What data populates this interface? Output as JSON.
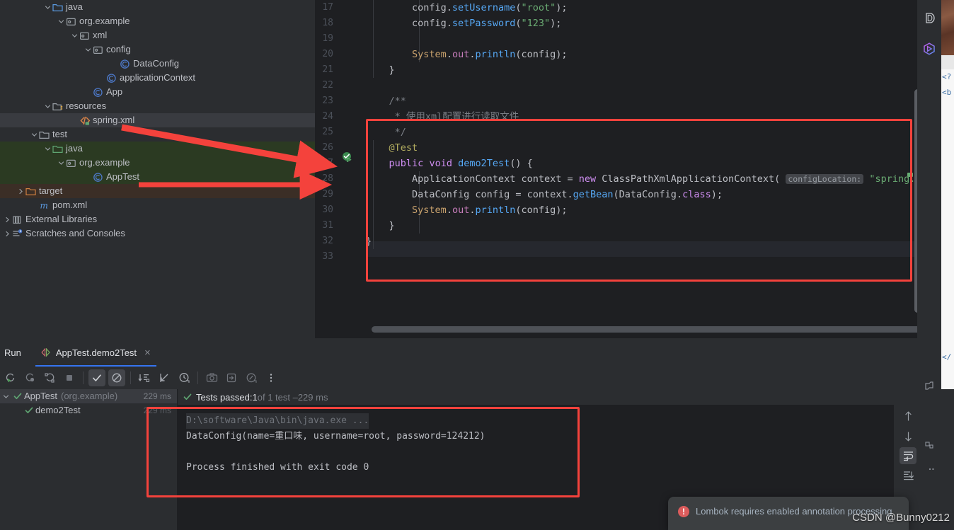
{
  "project_tree": {
    "items": [
      {
        "label": "java",
        "icon": "folder-source-icon",
        "indent": 3,
        "chevron": "down",
        "state": "normal"
      },
      {
        "label": "org.example",
        "icon": "package-icon",
        "indent": 4,
        "chevron": "down",
        "state": "normal"
      },
      {
        "label": "xml",
        "icon": "package-icon",
        "indent": 5,
        "chevron": "down",
        "state": "normal"
      },
      {
        "label": "config",
        "icon": "package-icon",
        "indent": 6,
        "chevron": "down",
        "state": "normal"
      },
      {
        "label": "DataConfig",
        "icon": "java-class-icon",
        "indent": 8,
        "chevron": "none",
        "state": "normal"
      },
      {
        "label": "applicationContext",
        "icon": "java-class-icon",
        "indent": 7,
        "chevron": "none",
        "state": "normal"
      },
      {
        "label": "App",
        "icon": "java-class-icon",
        "indent": 6,
        "chevron": "none",
        "state": "normal"
      },
      {
        "label": "resources",
        "icon": "folder-resources-icon",
        "indent": 3,
        "chevron": "down",
        "state": "normal"
      },
      {
        "label": "spring.xml",
        "icon": "xml-file-icon",
        "indent": 5,
        "chevron": "none",
        "state": "selected"
      },
      {
        "label": "test",
        "icon": "folder-icon",
        "indent": 2,
        "chevron": "down",
        "state": "normal"
      },
      {
        "label": "java",
        "icon": "folder-test-source-icon",
        "indent": 3,
        "chevron": "down",
        "state": "green"
      },
      {
        "label": "org.example",
        "icon": "package-icon",
        "indent": 4,
        "chevron": "down",
        "state": "green"
      },
      {
        "label": "AppTest",
        "icon": "java-class-icon",
        "indent": 6,
        "chevron": "none",
        "state": "green"
      },
      {
        "label": "target",
        "icon": "folder-excluded-icon",
        "indent": 1,
        "chevron": "right",
        "state": "brown"
      },
      {
        "label": "pom.xml",
        "icon": "maven-icon",
        "indent": 2,
        "chevron": "none",
        "state": "normal"
      },
      {
        "label": "External Libraries",
        "icon": "library-icon",
        "indent": 0,
        "chevron": "right",
        "state": "normal"
      },
      {
        "label": "Scratches and Consoles",
        "icon": "scratches-icon",
        "indent": 0,
        "chevron": "right",
        "state": "normal"
      }
    ]
  },
  "editor": {
    "first_line": 17,
    "line_numbers": [
      17,
      18,
      19,
      20,
      21,
      22,
      23,
      24,
      25,
      26,
      27,
      28,
      29,
      30,
      31,
      32,
      33
    ],
    "gutter_run_marker_line": 27,
    "lines": [
      {
        "n": 17,
        "tokens": [
          {
            "t": "        config.",
            "c": "typ"
          },
          {
            "t": "setUsername",
            "c": "mth"
          },
          {
            "t": "(",
            "c": "typ"
          },
          {
            "t": "\"root\"",
            "c": "str"
          },
          {
            "t": ");",
            "c": "typ"
          }
        ]
      },
      {
        "n": 18,
        "tokens": [
          {
            "t": "        config.",
            "c": "typ"
          },
          {
            "t": "setPassword",
            "c": "mth"
          },
          {
            "t": "(",
            "c": "typ"
          },
          {
            "t": "\"123\"",
            "c": "str"
          },
          {
            "t": ");",
            "c": "typ"
          }
        ]
      },
      {
        "n": 19,
        "tokens": []
      },
      {
        "n": 20,
        "tokens": [
          {
            "t": "        ",
            "c": "typ"
          },
          {
            "t": "System",
            "c": "stat"
          },
          {
            "t": ".",
            "c": "typ"
          },
          {
            "t": "out",
            "c": "fld"
          },
          {
            "t": ".",
            "c": "typ"
          },
          {
            "t": "println",
            "c": "mth"
          },
          {
            "t": "(config);",
            "c": "typ"
          }
        ]
      },
      {
        "n": 21,
        "tokens": [
          {
            "t": "    }",
            "c": "typ"
          }
        ]
      },
      {
        "n": 22,
        "tokens": []
      },
      {
        "n": 23,
        "tokens": [
          {
            "t": "    /**",
            "c": "cmt"
          }
        ]
      },
      {
        "n": 24,
        "tokens": [
          {
            "t": "     * 使用xml配置进行读取文件",
            "c": "cmt"
          }
        ]
      },
      {
        "n": 25,
        "tokens": [
          {
            "t": "     */",
            "c": "cmt"
          }
        ]
      },
      {
        "n": 26,
        "tokens": [
          {
            "t": "    @Test",
            "c": "ann"
          }
        ]
      },
      {
        "n": 27,
        "tokens": [
          {
            "t": "    ",
            "c": "typ"
          },
          {
            "t": "public",
            "c": "kw"
          },
          {
            "t": " ",
            "c": "typ"
          },
          {
            "t": "void",
            "c": "kw"
          },
          {
            "t": " ",
            "c": "typ"
          },
          {
            "t": "demo2Test",
            "c": "mth"
          },
          {
            "t": "() {",
            "c": "typ"
          }
        ]
      },
      {
        "n": 28,
        "tokens": [
          {
            "t": "        ApplicationContext context = ",
            "c": "typ"
          },
          {
            "t": "new",
            "c": "kw"
          },
          {
            "t": " ClassPathXmlApplicationContext( ",
            "c": "typ"
          },
          {
            "t": "configLocation:",
            "c": "hint"
          },
          {
            "t": " ",
            "c": "typ"
          },
          {
            "t": "\"spring.xml\"",
            "c": "str"
          }
        ]
      },
      {
        "n": 29,
        "tokens": [
          {
            "t": "        DataConfig config = context.",
            "c": "typ"
          },
          {
            "t": "getBean",
            "c": "mth"
          },
          {
            "t": "(DataConfig.",
            "c": "typ"
          },
          {
            "t": "class",
            "c": "kw"
          },
          {
            "t": ");",
            "c": "typ"
          }
        ]
      },
      {
        "n": 30,
        "tokens": [
          {
            "t": "        ",
            "c": "typ"
          },
          {
            "t": "System",
            "c": "stat"
          },
          {
            "t": ".",
            "c": "typ"
          },
          {
            "t": "out",
            "c": "fld"
          },
          {
            "t": ".",
            "c": "typ"
          },
          {
            "t": "println",
            "c": "mth"
          },
          {
            "t": "(config);",
            "c": "typ"
          }
        ]
      },
      {
        "n": 31,
        "tokens": [
          {
            "t": "    }",
            "c": "typ"
          }
        ]
      },
      {
        "n": 32,
        "tokens": [
          {
            "t": "}",
            "c": "typ"
          }
        ]
      },
      {
        "n": 33,
        "tokens": []
      }
    ]
  },
  "run_panel": {
    "title": "Run",
    "tab_label": "AppTest.demo2Test",
    "tab_close": "×",
    "toolbar": [
      {
        "name": "rerun-icon"
      },
      {
        "name": "rerun-failed-icon"
      },
      {
        "name": "toggle-auto-test-icon"
      },
      {
        "name": "stop-icon"
      },
      {
        "name": "show-passed-icon",
        "active": true
      },
      {
        "name": "show-ignored-icon",
        "active": true
      },
      {
        "name": "sort-alphabetically-icon"
      },
      {
        "name": "collapse-all-icon"
      },
      {
        "name": "history-icon"
      },
      {
        "name": "screenshot-icon"
      },
      {
        "name": "export-icon"
      },
      {
        "name": "profiler-icon"
      },
      {
        "name": "more-options-icon"
      }
    ],
    "tests": [
      {
        "label": "AppTest",
        "suffix": "(org.example)",
        "duration": "229 ms",
        "status": "passed",
        "indent": 0,
        "selected": true
      },
      {
        "label": "demo2Test",
        "suffix": "",
        "duration": "229 ms",
        "status": "passed",
        "indent": 1,
        "selected": false
      }
    ],
    "summary": {
      "prefix": "Tests passed: ",
      "count": "1",
      "middle": " of 1 test – ",
      "time": "229 ms"
    },
    "console_lines": [
      {
        "text": "D:\\software\\Java\\bin\\java.exe ...",
        "style": "dim"
      },
      {
        "text": "DataConfig(name=重口味, username=root, password=124212)",
        "style": "normal"
      },
      {
        "text": "",
        "style": "normal"
      },
      {
        "text": "Process finished with exit code 0",
        "style": "normal"
      }
    ],
    "console_side_buttons": [
      {
        "name": "scroll-up-icon",
        "active": false
      },
      {
        "name": "scroll-down-icon",
        "active": false
      },
      {
        "name": "soft-wrap-icon",
        "active": true
      },
      {
        "name": "scroll-to-end-icon",
        "active": false
      }
    ]
  },
  "right_strip": {
    "icons": [
      {
        "name": "database-icon",
        "glyph": "D"
      },
      {
        "name": "maven-tool-icon",
        "glyph": "◈"
      },
      {
        "name": "structure-icon",
        "glyph": "▱"
      },
      {
        "name": "bookmarks-icon",
        "glyph": "▫"
      }
    ]
  },
  "background_window": {
    "lines": [
      "<?",
      "<b",
      "</"
    ]
  },
  "notification": {
    "icon": "error-icon",
    "icon_glyph": "!",
    "text": "Lombok requires enabled annotation processing"
  },
  "watermark": {
    "text": "CSDN @Bunny0212"
  },
  "annotations": {
    "boxes": [
      {
        "name": "editor-highlight-box"
      },
      {
        "name": "console-highlight-box"
      }
    ],
    "arrows": [
      {
        "name": "arrow-spring-xml-to-editor"
      },
      {
        "name": "arrow-apptest-to-editor"
      }
    ]
  },
  "colors": {
    "accent": "#3574f0",
    "annotation_red": "#f4423c",
    "pass_green": "#59a869",
    "error_red": "#db5c5c",
    "editor_bg": "#1e1f22",
    "panel_bg": "#2b2d30"
  }
}
